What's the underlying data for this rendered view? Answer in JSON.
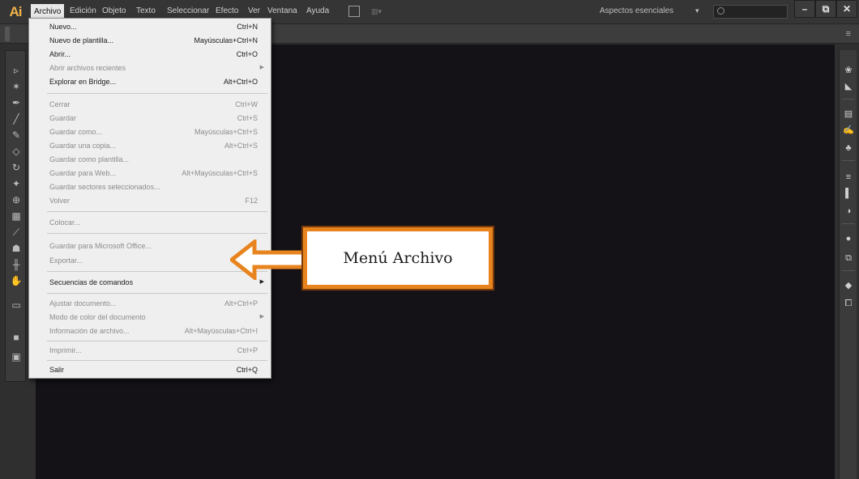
{
  "app": {
    "logo": "Ai"
  },
  "menubar": {
    "items": [
      "Archivo",
      "Edición",
      "Objeto",
      "Texto",
      "Seleccionar",
      "Efecto",
      "Ver",
      "Ventana",
      "Ayuda"
    ],
    "active": "Archivo",
    "workspace": "Aspectos esenciales",
    "workspace_caret": "▾",
    "window_buttons": [
      "–",
      "⧉",
      "✕"
    ]
  },
  "file_menu": {
    "items": [
      {
        "label": "Nuevo...",
        "shortcut": "Ctrl+N",
        "enabled": true
      },
      {
        "label": "Nuevo de plantilla...",
        "shortcut": "Mayúsculas+Ctrl+N",
        "enabled": true
      },
      {
        "label": "Abrir...",
        "shortcut": "Ctrl+O",
        "enabled": true
      },
      {
        "label": "Abrir archivos recientes",
        "shortcut": "",
        "enabled": false,
        "submenu": true
      },
      {
        "label": "Explorar en Bridge...",
        "shortcut": "Alt+Ctrl+O",
        "enabled": true
      },
      {
        "label": "Cerrar",
        "shortcut": "Ctrl+W",
        "enabled": false
      },
      {
        "label": "Guardar",
        "shortcut": "Ctrl+S",
        "enabled": false
      },
      {
        "label": "Guardar como...",
        "shortcut": "Mayúsculas+Ctrl+S",
        "enabled": false
      },
      {
        "label": "Guardar una copia...",
        "shortcut": "Alt+Ctrl+S",
        "enabled": false
      },
      {
        "label": "Guardar como plantilla...",
        "shortcut": "",
        "enabled": false
      },
      {
        "label": "Guardar para Web...",
        "shortcut": "Alt+Mayúsculas+Ctrl+S",
        "enabled": false
      },
      {
        "label": "Guardar sectores seleccionados...",
        "shortcut": "",
        "enabled": false
      },
      {
        "label": "Volver",
        "shortcut": "F12",
        "enabled": false
      },
      {
        "label": "Colocar...",
        "shortcut": "",
        "enabled": false
      },
      {
        "label": "Guardar para Microsoft Office...",
        "shortcut": "",
        "enabled": false
      },
      {
        "label": "Exportar...",
        "shortcut": "",
        "enabled": false
      },
      {
        "label": "Secuencias de comandos",
        "shortcut": "",
        "enabled": true,
        "submenu": true
      },
      {
        "label": "Ajustar documento...",
        "shortcut": "Alt+Ctrl+P",
        "enabled": false
      },
      {
        "label": "Modo de color del documento",
        "shortcut": "",
        "enabled": false,
        "submenu": true
      },
      {
        "label": "Información de archivo...",
        "shortcut": "Alt+Mayúsculas+Ctrl+I",
        "enabled": false
      },
      {
        "label": "Imprimir...",
        "shortcut": "Ctrl+P",
        "enabled": false
      },
      {
        "label": "Salir",
        "shortcut": "Ctrl+Q",
        "enabled": true
      }
    ]
  },
  "callout": {
    "text": "Menú Archivo",
    "border_color": "#e8841f"
  },
  "colors": {
    "canvas": "#141216",
    "chrome": "#353535",
    "accent": "#e8841f"
  }
}
